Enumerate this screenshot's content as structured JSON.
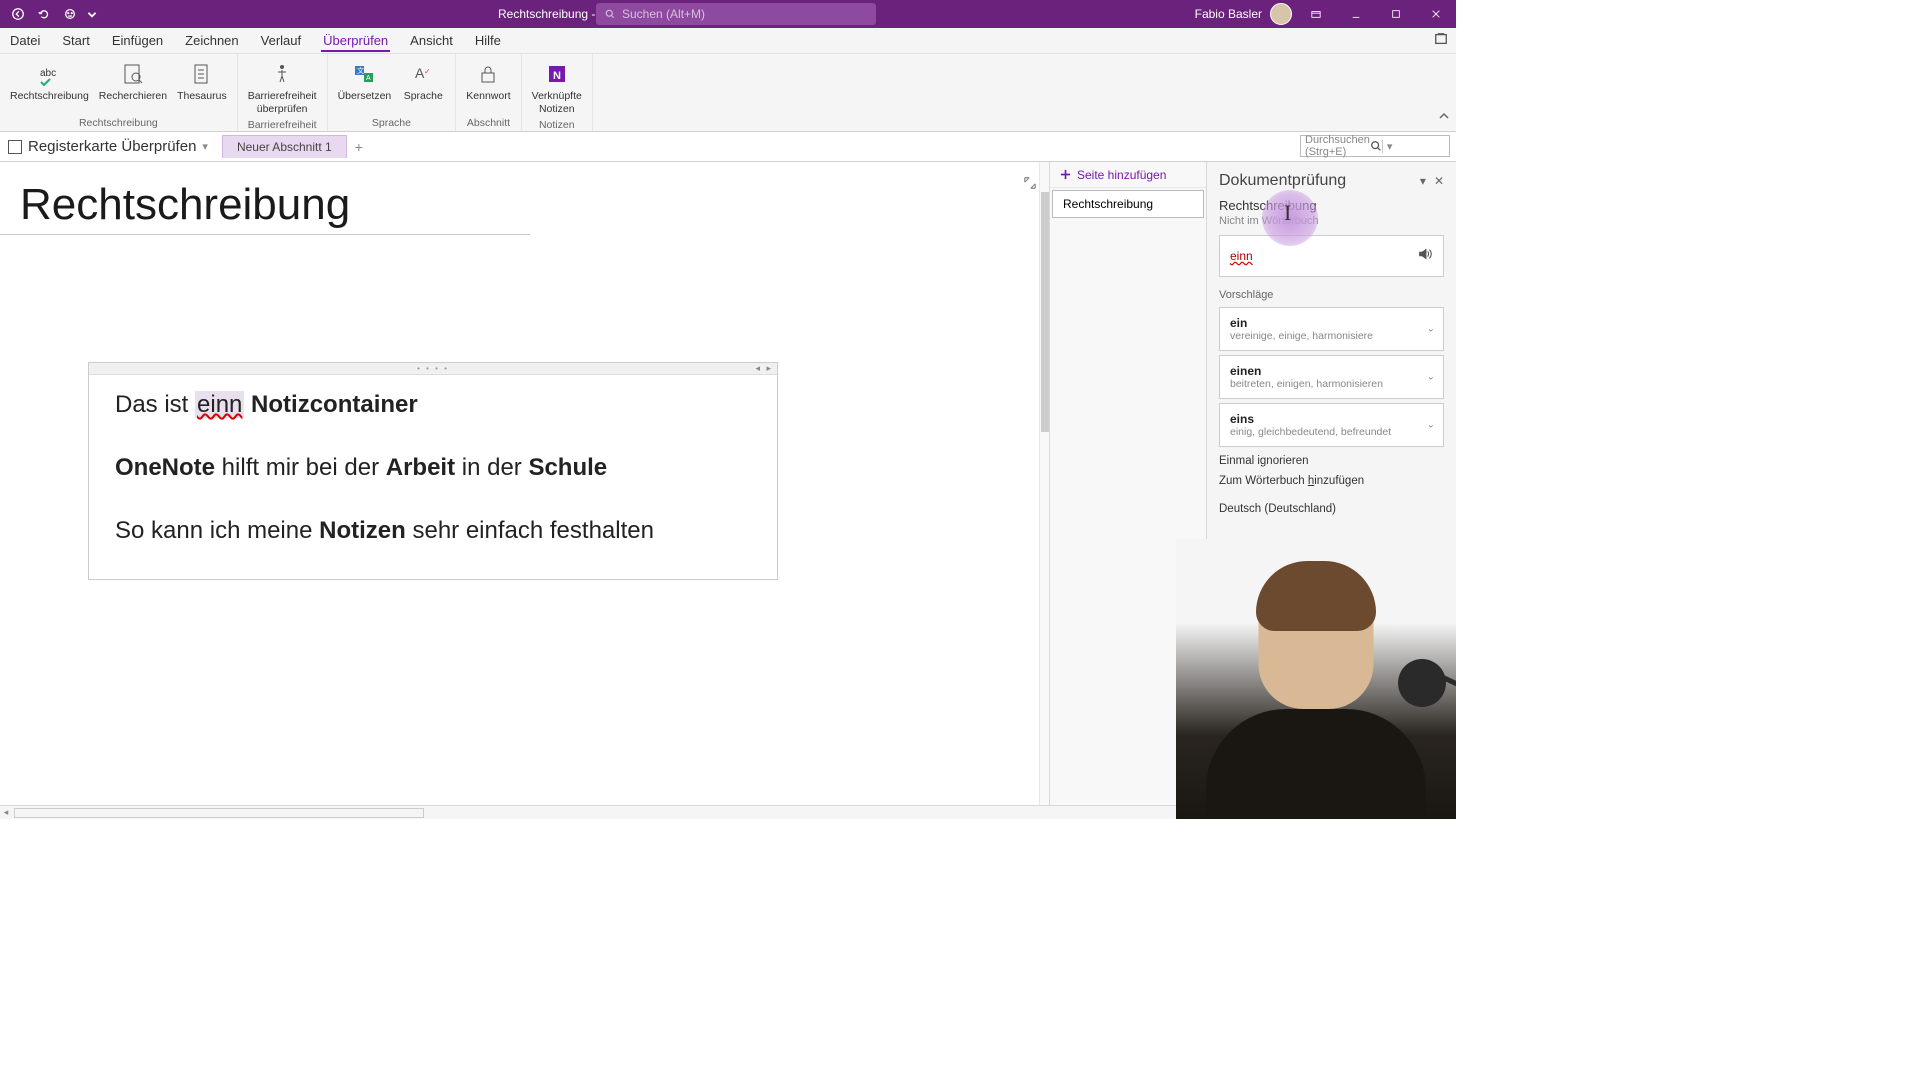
{
  "titlebar": {
    "doc_title": "Rechtschreibung - OneNote",
    "search_placeholder": "Suchen (Alt+M)",
    "user": "Fabio Basler"
  },
  "menu": {
    "items": [
      "Datei",
      "Start",
      "Einfügen",
      "Zeichnen",
      "Verlauf",
      "Überprüfen",
      "Ansicht",
      "Hilfe"
    ],
    "active_index": 5
  },
  "ribbon": {
    "groups": [
      {
        "label": "Rechtschreibung",
        "items": [
          {
            "label": "Rechtschreibung"
          },
          {
            "label": "Recherchieren"
          },
          {
            "label": "Thesaurus"
          }
        ]
      },
      {
        "label": "Barrierefreiheit",
        "items": [
          {
            "label": "Barrierefreiheit\nüberprüfen"
          }
        ]
      },
      {
        "label": "Sprache",
        "items": [
          {
            "label": "Übersetzen"
          },
          {
            "label": "Sprache"
          }
        ]
      },
      {
        "label": "Abschnitt",
        "items": [
          {
            "label": "Kennwort"
          }
        ]
      },
      {
        "label": "Notizen",
        "items": [
          {
            "label": "Verknüpfte\nNotizen"
          }
        ]
      }
    ]
  },
  "notebook": {
    "name": "Registerkarte Überprüfen",
    "section_tab": "Neuer Abschnitt 1",
    "search_placeholder": "Durchsuchen (Strg+E)",
    "add_page": "Seite hinzufügen",
    "page_item": "Rechtschreibung"
  },
  "page": {
    "title": "Rechtschreibung",
    "line1_pre": "Das ist ",
    "line1_err": "einn",
    "line1_post": " Notizcontainer",
    "line2_b1": "OneNote",
    "line2_mid": " hilft mir bei der ",
    "line2_b2": "Arbeit",
    "line2_mid2": " in der ",
    "line2_b3": "Schule",
    "line3_pre": "So kann ich meine ",
    "line3_b": "Notizen",
    "line3_post": " sehr einfach festhalten"
  },
  "panel": {
    "title": "Dokumentprüfung",
    "subtitle": "Rechtschreibung",
    "note": "Nicht im Wörterbuch",
    "word": "einn",
    "suggestions_label": "Vorschläge",
    "suggestions": [
      {
        "word": "ein",
        "meta": "vereinige, einige, harmonisiere"
      },
      {
        "word": "einen",
        "meta": "beitreten, einigen, harmonisieren"
      },
      {
        "word": "eins",
        "meta": "einig, gleichbedeutend, befreundet"
      }
    ],
    "ignore_once": "Einmal ignorieren",
    "add_dict_pre": "Zum Wörterbuch ",
    "add_dict_key": "h",
    "add_dict_post": "inzufügen",
    "language": "Deutsch (Deutschland)"
  }
}
